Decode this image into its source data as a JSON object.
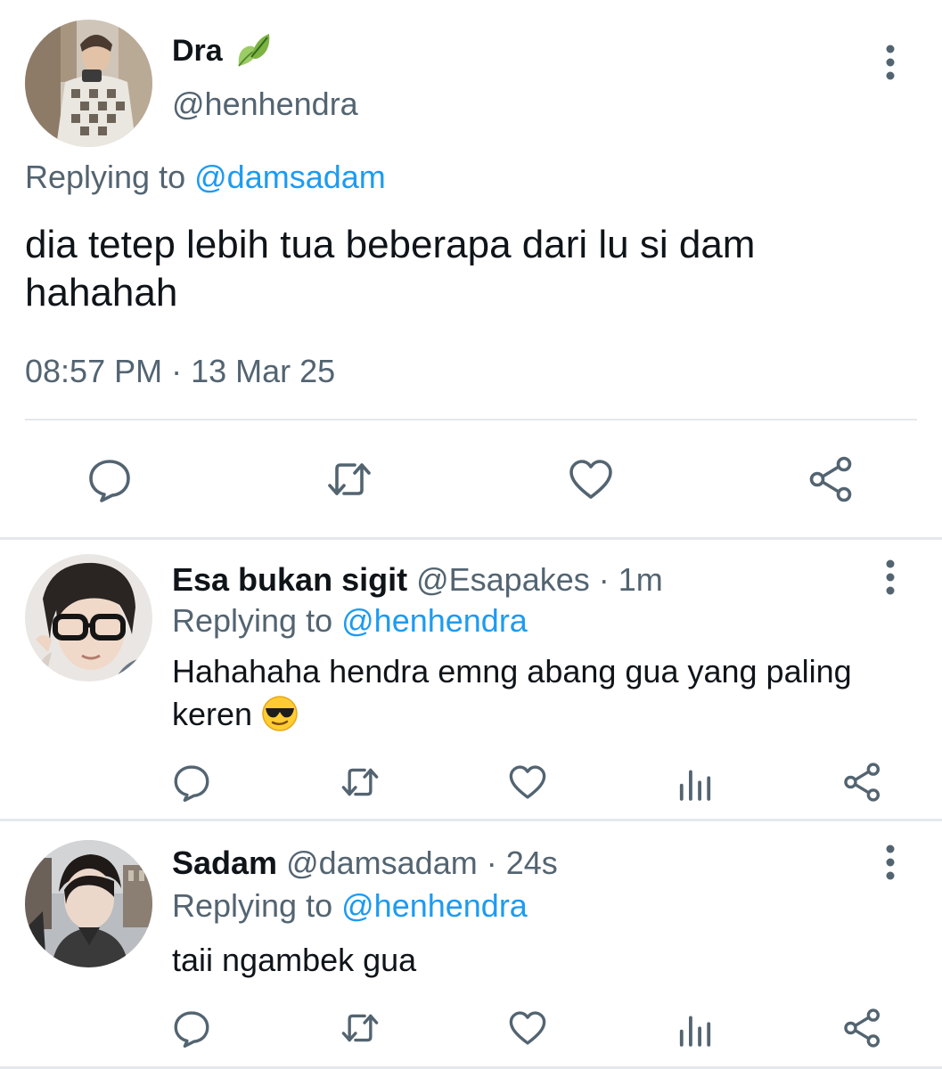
{
  "main_tweet": {
    "author_name": "Dra",
    "author_badge_icon": "leaf-emoji",
    "author_handle": "@henhendra",
    "replying_prefix": "Replying to",
    "replying_to": "@damsadam",
    "text": "dia tetep lebih tua beberapa dari lu si dam hahahah",
    "timestamp": "08:57 PM · 13 Mar 25",
    "actions": [
      "reply-icon",
      "retweet-icon",
      "like-icon",
      "share-icon"
    ]
  },
  "replies": [
    {
      "author_name": "Esa bukan sigit",
      "author_handle": "@Esapakes",
      "time": " · 1m",
      "replying_prefix": "Replying to",
      "replying_to": "@henhendra",
      "text": "Hahahaha hendra emng abang gua yang paling keren",
      "emoji": "sunglasses-emoji",
      "actions": [
        "reply-icon",
        "retweet-icon",
        "like-icon",
        "analytics-icon",
        "share-icon"
      ]
    },
    {
      "author_name": "Sadam",
      "author_handle": "@damsadam",
      "time": " · 24s",
      "replying_prefix": "Replying to",
      "replying_to": "@henhendra",
      "text": "taii ngambek gua",
      "actions": [
        "reply-icon",
        "retweet-icon",
        "like-icon",
        "analytics-icon",
        "share-icon"
      ]
    }
  ],
  "colors": {
    "text_primary": "#0f1419",
    "text_secondary": "#536471",
    "link": "#1d9bf0",
    "icon": "#536471",
    "divider": "#e3e8ec"
  }
}
